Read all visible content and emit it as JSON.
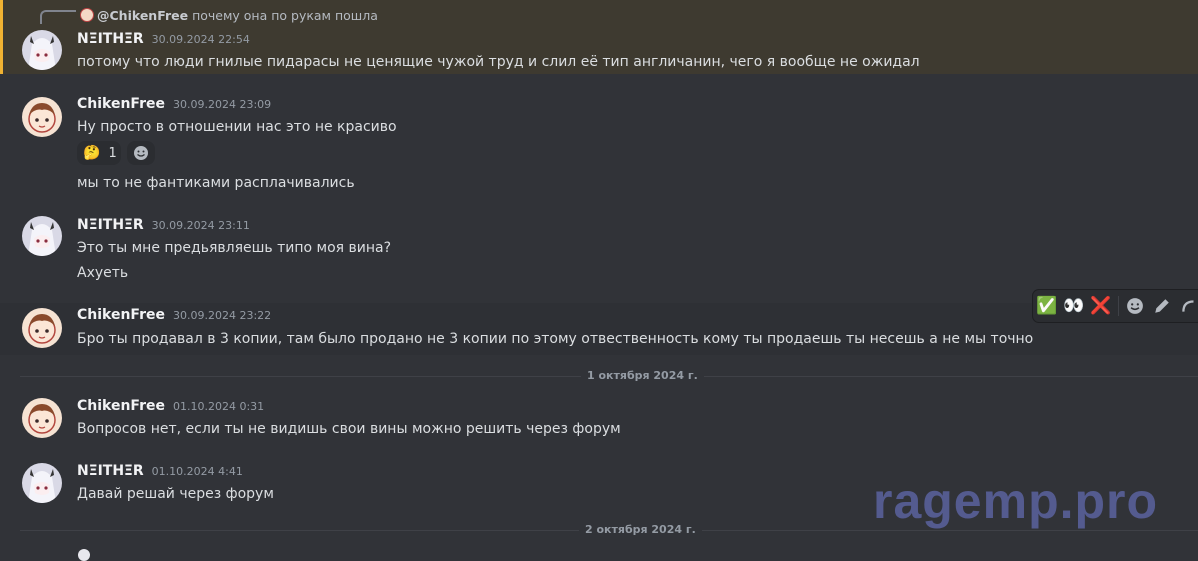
{
  "reply": {
    "author": "@ChikenFree",
    "text": "почему она по рукам пошла"
  },
  "messages": [
    {
      "author": "NΞITHΞR",
      "timestamp": "30.09.2024 22:54",
      "lines": [
        "потому что люди гнилые пидарасы не ценящие чужой труд и слил её тип англичанин, чего я вообще не ожидал"
      ]
    },
    {
      "author": "ChikenFree",
      "timestamp": "30.09.2024 23:09",
      "lines": [
        "Ну просто в отношении нас это не красиво",
        "мы то не фантиками расплачивались"
      ]
    },
    {
      "author": "NΞITHΞR",
      "timestamp": "30.09.2024 23:11",
      "lines": [
        "Это ты мне предьявляешь типо моя вина?",
        "Ахуеть"
      ]
    },
    {
      "author": "ChikenFree",
      "timestamp": "30.09.2024 23:22",
      "lines": [
        "Бро ты продавал в 3 копии, там было продано не 3 копии по этому отвественность кому ты продаешь ты несешь а не мы точно"
      ]
    },
    {
      "author": "ChikenFree",
      "timestamp": "01.10.2024 0:31",
      "lines": [
        "Вопросов нет, если ты не видишь свои вины можно решить через форум"
      ]
    },
    {
      "author": "NΞITHΞR",
      "timestamp": "01.10.2024 4:41",
      "lines": [
        "Давай решай через форум"
      ]
    }
  ],
  "reaction": {
    "emoji": "🤔",
    "count": "1"
  },
  "dividers": [
    "1 октября 2024 г.",
    "2 октября 2024 г."
  ],
  "toolbar": {
    "icons": [
      "check-mark-emoji-icon",
      "eyes-emoji-icon",
      "cross-mark-emoji-icon",
      "add-reaction-icon",
      "edit-icon",
      "reply-icon"
    ],
    "check": "✅",
    "eyes": "👀",
    "cross": "❌"
  },
  "watermark": "ragemp.pro",
  "colors": {
    "background": "#313338",
    "highlight": "#3e3a30",
    "highlight_border": "#f0b232",
    "text": "#dbdee1",
    "muted": "#949ba4"
  }
}
